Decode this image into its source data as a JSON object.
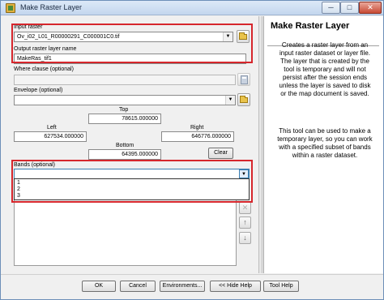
{
  "window": {
    "title": "Make Raster Layer",
    "minimize": "─",
    "maximize": "□",
    "close": "✕"
  },
  "form": {
    "input_raster": {
      "label": "Input raster",
      "value": "Ov_i02_L01_R00000291_C000001C0.tif",
      "icon": "folder-icon"
    },
    "output_layer": {
      "label": "Output raster layer name",
      "value": "MakeRas_tif1"
    },
    "where_clause": {
      "label": "Where clause (optional)",
      "value": "",
      "icon": "sql-calculator-icon"
    },
    "envelope": {
      "label": "Envelope (optional)",
      "value": "",
      "icon": "folder-icon",
      "top_label": "Top",
      "top_value": "78615.000000",
      "left_label": "Left",
      "left_value": "627534.000000",
      "right_label": "Right",
      "right_value": "646776.000000",
      "bottom_label": "Bottom",
      "bottom_value": "64395.000000",
      "clear_label": "Clear"
    },
    "bands": {
      "label": "Bands (optional)",
      "value": "",
      "options": [
        "1",
        "2",
        "3"
      ]
    }
  },
  "side_tools": {
    "delete": "✕",
    "up": "↑",
    "down": "↓"
  },
  "help": {
    "title": "Make Raster Layer",
    "paragraph1": "Creates a raster layer from an input raster dataset or layer file. The layer that is created by the tool is temporary and will not persist after the session ends unless the layer is saved to disk or the map document is saved.",
    "paragraph2": "This tool can be used to make a temporary layer, so you can work with a specified subset of bands within a raster dataset."
  },
  "buttons": {
    "ok": "OK",
    "cancel": "Cancel",
    "environments": "Environments...",
    "hide_help": "<< Hide Help",
    "tool_help": "Tool Help"
  },
  "colors": {
    "highlight": "#d6262c",
    "title_bar": "#c3d6ee"
  }
}
